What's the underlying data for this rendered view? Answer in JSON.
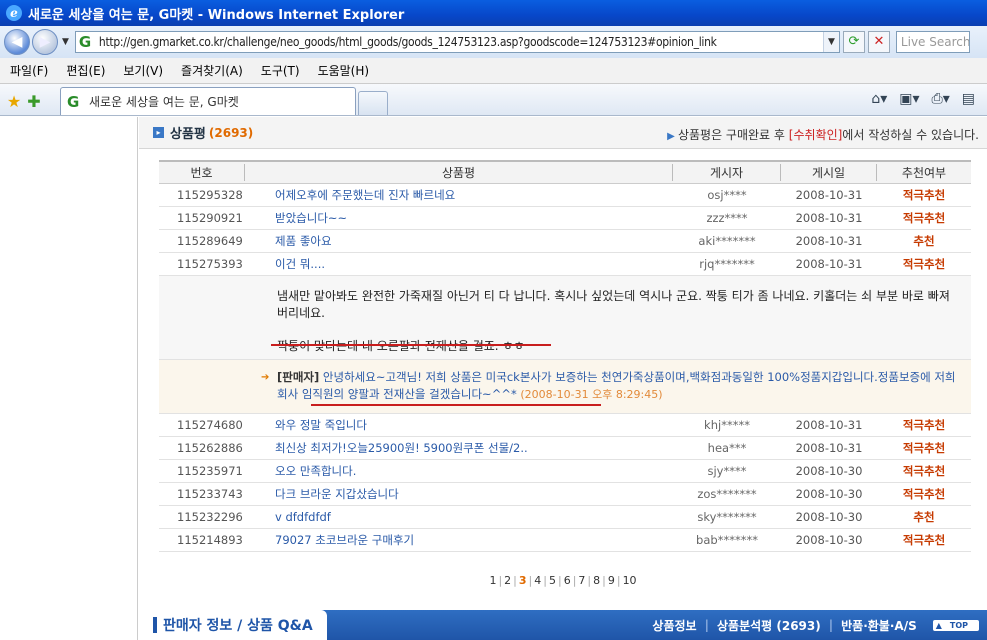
{
  "window": {
    "title": "새로운 세상을 여는 문, G마켓 - Windows Internet Explorer"
  },
  "address": {
    "url": "http://gen.gmarket.co.kr/challenge/neo_goods/html_goods/goods_124753123.asp?goodscode=124753123#opinion_link",
    "search_placeholder": "Live Search"
  },
  "menu": [
    "파일(F)",
    "편집(E)",
    "보기(V)",
    "즐겨찾기(A)",
    "도구(T)",
    "도움말(H)"
  ],
  "tab": {
    "title": "새로운 세상을 여는 문, G마켓"
  },
  "section": {
    "title": "상품평",
    "count": "(2693)",
    "notice_pre": "상품평은 구매완료 후 ",
    "notice_hl": "[수취확인]",
    "notice_post": "에서 작성하실 수 있습니다."
  },
  "columns": [
    "번호",
    "상품평",
    "게시자",
    "게시일",
    "추천여부"
  ],
  "rows_top": [
    {
      "no": "115295328",
      "title": "어제오후에 주문했는데 진자 빠르네요",
      "author": "osj****",
      "date": "2008-10-31",
      "rec": "적극추천"
    },
    {
      "no": "115290921",
      "title": "받았습니다~~",
      "author": "zzz****",
      "date": "2008-10-31",
      "rec": "적극추천"
    },
    {
      "no": "115289649",
      "title": "제품 좋아요",
      "author": "aki*******",
      "date": "2008-10-31",
      "rec": "추천"
    },
    {
      "no": "115275393",
      "title": "이건 뭐....",
      "author": "rjq*******",
      "date": "2008-10-31",
      "rec": "적극추천"
    }
  ],
  "review": {
    "line1": "냄새만 맡아봐도 완전한 가죽재질 아닌거 티 다 납니다. 혹시나 싶었는데 역시나 군요. 짝퉁 티가 좀 나네요. 키홀더는 쇠 부분 바로 빠져 버리네요.",
    "line2": "짝퉁이 맞다는데 내 오른팔과 전재산을 걸죠. ㅎㅎ"
  },
  "seller_reply": {
    "tag": "[판매자]",
    "text": " 안녕하세요~고객님! 저희 상품은 미국ck본사가 보증하는 천연가죽상품이며,백화점과동일한 100%정품지갑입니다.정품보증에 저희회사 임직원의 양팔과 전재산을 걸겠습니다~^^* ",
    "date": "(2008-10-31 오후 8:29:45)"
  },
  "rows_bottom": [
    {
      "no": "115274680",
      "title": "와우 정말 죽입니다",
      "author": "khj*****",
      "date": "2008-10-31",
      "rec": "적극추천"
    },
    {
      "no": "115262886",
      "title": "최신상 최저가!오늘25900원! 5900원쿠폰 선물/2..",
      "author": "hea***",
      "date": "2008-10-31",
      "rec": "적극추천"
    },
    {
      "no": "115235971",
      "title": "오오 만족합니다.",
      "author": "sjy****",
      "date": "2008-10-30",
      "rec": "적극추천"
    },
    {
      "no": "115233743",
      "title": "다크 브라운 지갑샀습니다",
      "author": "zos*******",
      "date": "2008-10-30",
      "rec": "적극추천"
    },
    {
      "no": "115232296",
      "title": "v dfdfdfdf",
      "author": "sky*******",
      "date": "2008-10-30",
      "rec": "추천"
    },
    {
      "no": "115214893",
      "title": "79027 초코브라운 구매후기",
      "author": "bab*******",
      "date": "2008-10-30",
      "rec": "적극추천"
    }
  ],
  "pager": {
    "pages": [
      "1",
      "2",
      "3",
      "4",
      "5",
      "6",
      "7",
      "8",
      "9",
      "10"
    ],
    "current": "3"
  },
  "bottom": {
    "title": "판매자 정보 / 상품 Q&A",
    "link1": "상품정보",
    "link2": "상품분석평 (2693)",
    "link3": "반품·환불·A/S",
    "top": "TOP"
  }
}
